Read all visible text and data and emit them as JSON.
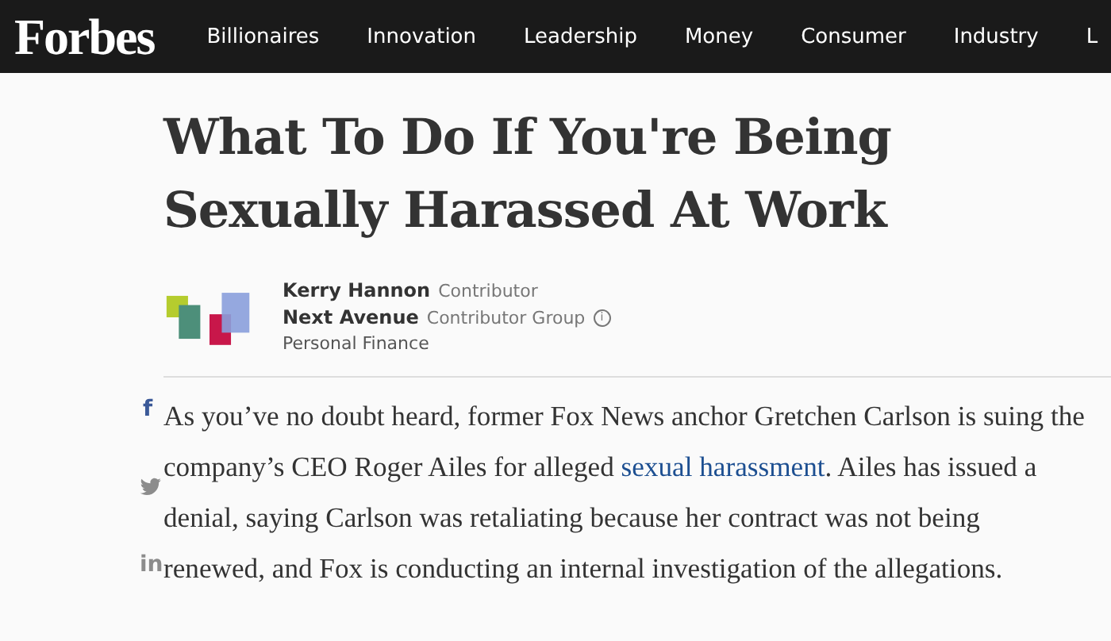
{
  "header": {
    "logo": "Forbes",
    "nav": [
      "Billionaires",
      "Innovation",
      "Leadership",
      "Money",
      "Consumer",
      "Industry",
      "L"
    ]
  },
  "article": {
    "title": "What To Do If You're Being Sexually Harassed At Work",
    "byline": {
      "author": "Kerry Hannon",
      "author_role": "Contributor",
      "group": "Next Avenue",
      "group_role": "Contributor Group",
      "info_glyph": "i",
      "section": "Personal Finance"
    },
    "share": [
      {
        "kind": "facebook",
        "glyph": "f"
      },
      {
        "kind": "twitter"
      },
      {
        "kind": "linkedin",
        "glyph": "in"
      }
    ],
    "paragraph": {
      "before": "As you’ve no doubt heard, former Fox News anchor Gretchen Carlson is suing the company’s CEO Roger Ailes for alleged ",
      "link": "sexual harassment",
      "after": ". Ailes has issued a denial, saying Carlson was retaliating because her contract was not being renewed, and Fox is conducting an internal investigation of the allegations."
    }
  }
}
